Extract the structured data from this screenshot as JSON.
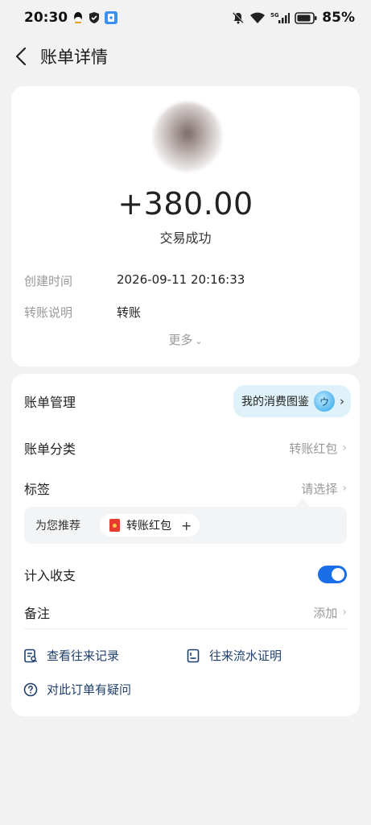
{
  "status_bar": {
    "time": "20:30",
    "network": "5G",
    "battery": "85%",
    "icons": [
      "qq-icon",
      "shield-icon",
      "app-icon",
      "mute-icon",
      "wifi-icon",
      "signal-icon",
      "battery-icon"
    ]
  },
  "nav": {
    "title": "账单详情"
  },
  "transaction": {
    "amount": "+380.00",
    "status": "交易成功",
    "created_label": "创建时间",
    "created_value": "2026-09-11 20:16:33",
    "desc_label": "转账说明",
    "desc_value": "转账",
    "more_label": "更多",
    "more_chevron": "⌄"
  },
  "management": {
    "title": "账单管理",
    "pill_label": "我的消费图鉴",
    "pill_mascot": "ウ",
    "pill_arrow": "›",
    "category_label": "账单分类",
    "category_value": "转账红包",
    "tag_label": "标签",
    "tag_value": "请选择",
    "recommend_label": "为您推荐",
    "recommend_chip": "转账红包",
    "recommend_add": "+",
    "count_label": "计入收支",
    "count_enabled": true,
    "note_label": "备注",
    "note_value": "添加",
    "arrow": "›"
  },
  "links": {
    "history": "查看往来记录",
    "proof": "往来流水证明",
    "question": "对此订单有疑问"
  },
  "colors": {
    "accent": "#1a6fe8",
    "link": "#1f3f6e",
    "pill_bg": "#dff2fa",
    "page_bg": "#f2f2f2"
  }
}
